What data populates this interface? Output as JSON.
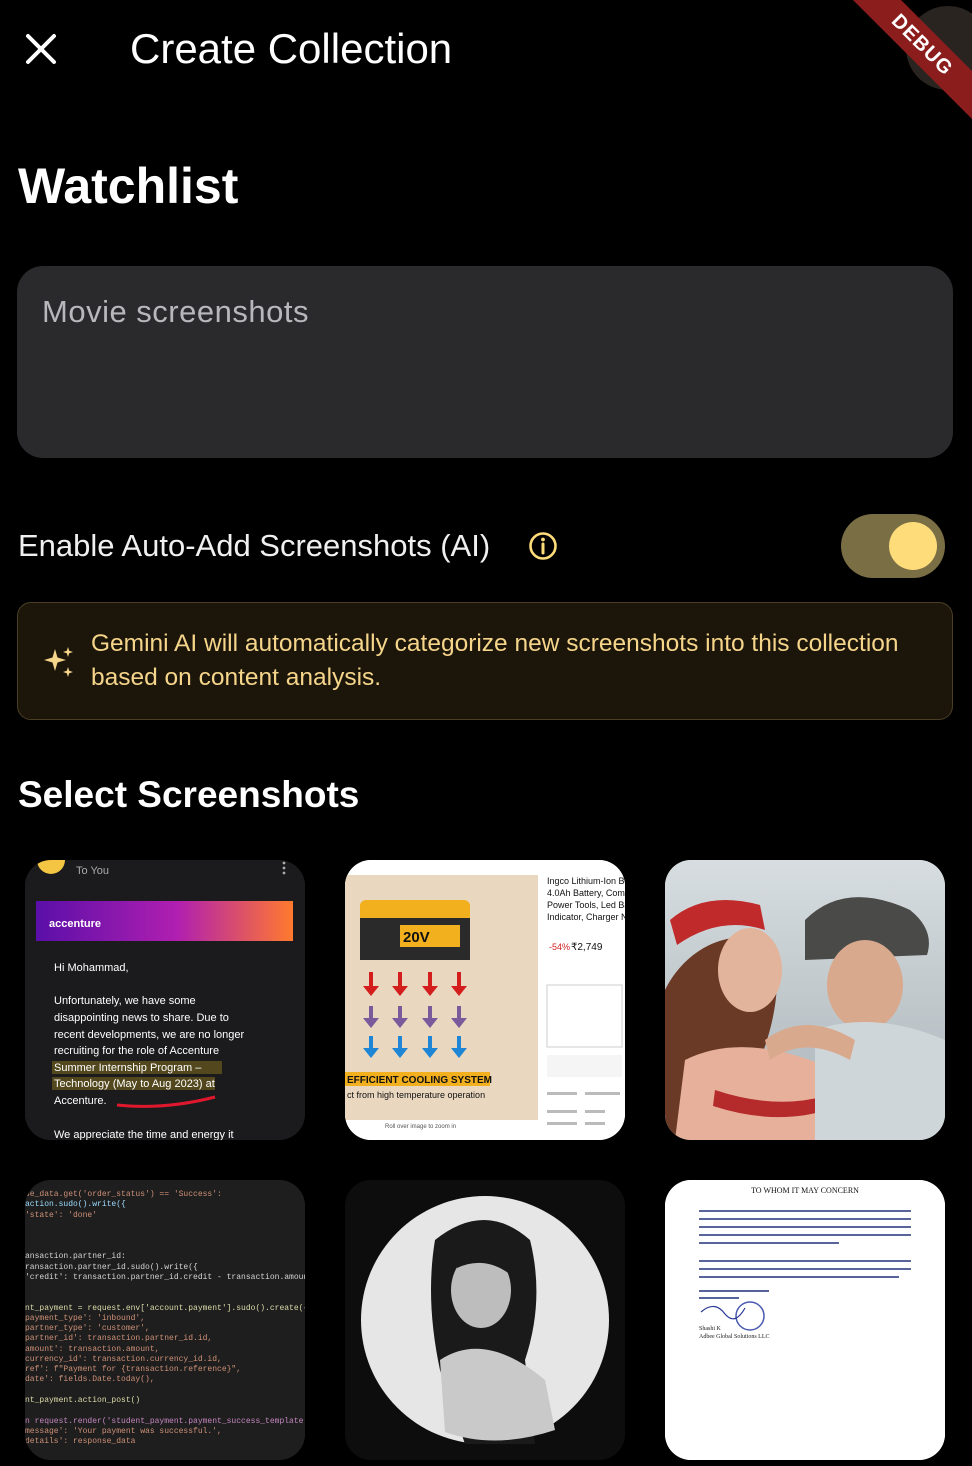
{
  "appbar": {
    "title": "Create Collection",
    "close_icon": "close-icon",
    "debug_badge": "DEBUG"
  },
  "collection": {
    "name": "Watchlist",
    "description_placeholder": "Movie screenshots",
    "description_value": ""
  },
  "auto_add": {
    "label": "Enable Auto-Add Screenshots (AI)",
    "info_icon": "info-icon",
    "enabled": true
  },
  "ai_banner": {
    "icon": "sparkle-icon",
    "text": "Gemini AI will automatically categorize new screenshots into this collection based on content analysis."
  },
  "screenshots_section": {
    "heading": "Select Screenshots",
    "items": [
      {
        "kind": "email",
        "header": "To You",
        "brand": "accenture",
        "greeting": "Hi Mohammad,",
        "lines": [
          "Unfortunately, we have some",
          "disappointing news to share. Due to",
          "recent developments, we are no longer",
          "recruiting for the role of Accenture",
          "Summer Internship Program –",
          "Technology (May to Aug 2023) at",
          "Accenture."
        ],
        "footer": "We appreciate the time and energy it"
      },
      {
        "kind": "product",
        "badge": "20V",
        "caption_banner": "EFFICIENT COOLING SYSTEM",
        "caption_sub": "ct from high temperature operation",
        "title_lines": [
          "Ingco Lithium-Ion B",
          "4.0Ah Battery, Com",
          "Power Tools, Led Ba",
          "Indicator, Charger N"
        ],
        "price": "₹2,749",
        "discount": "-54%",
        "hint": "Roll over image to zoom in"
      },
      {
        "kind": "photo-couple"
      },
      {
        "kind": "code",
        "lines": [
          "se_data.get('order_status') == 'Success':",
          "action.sudo().write({",
          "  'state': 'done'",
          "",
          "ansaction.partner_id:",
          "ransaction.partner_id.sudo().write({",
          "  'credit': transaction.partner_id.credit - transaction.amoun",
          "",
          "nt_payment = request.env['account.payment'].sudo().create({",
          "payment_type': 'inbound',",
          "partner_type': 'customer',",
          "partner_id': transaction.partner_id.id,",
          "amount': transaction.amount,",
          "currency_id': transaction.currency_id.id,",
          "ref': f\"Payment for {transaction.reference}\",",
          "date': fields.Date.today(),",
          "",
          "nt_payment.action_post()",
          "",
          "n request.render('student_payment.payment_success_template', {",
          "message': 'Your payment was successful.',",
          "details': response_data"
        ]
      },
      {
        "kind": "photo-portrait"
      },
      {
        "kind": "letter",
        "heading": "TO WHOM IT MAY CONCERN",
        "signature": "Shashi K",
        "company": "Adbee Global Solutions LLC"
      }
    ]
  },
  "colors": {
    "background": "#000000",
    "field": "#2a2a2c",
    "accent": "#ffdc7a",
    "switch_track": "#7a6e45",
    "banner_bg": "#1c150a",
    "banner_text": "#f5d58a"
  }
}
